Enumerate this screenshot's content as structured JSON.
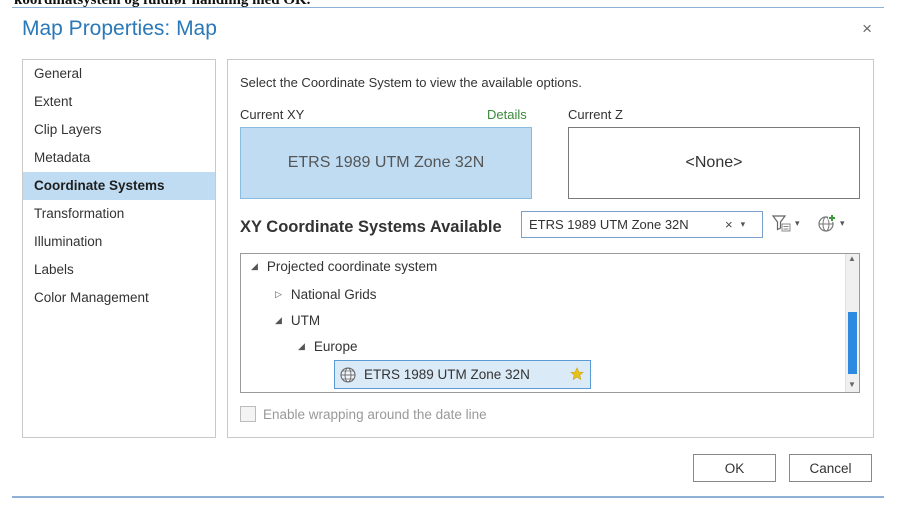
{
  "document": {
    "top_text": "koordinatsystem og fuldfør handling med OK."
  },
  "dialog": {
    "title": "Map Properties: Map",
    "close_glyph": "×",
    "nav": [
      {
        "label": "General"
      },
      {
        "label": "Extent"
      },
      {
        "label": "Clip Layers"
      },
      {
        "label": "Metadata"
      },
      {
        "label": "Coordinate Systems",
        "active": true
      },
      {
        "label": "Transformation"
      },
      {
        "label": "Illumination"
      },
      {
        "label": "Labels"
      },
      {
        "label": "Color Management"
      }
    ],
    "panel": {
      "instruction": "Select the Coordinate System to view the available options.",
      "current_xy_label": "Current XY",
      "details_link": "Details",
      "current_z_label": "Current Z",
      "current_xy_value": "ETRS 1989 UTM Zone 32N",
      "current_z_value": "<None>",
      "available_heading": "XY Coordinate Systems Available",
      "search_value": "ETRS 1989 UTM Zone 32N",
      "search_clear": "×",
      "tree": {
        "projected": "Projected coordinate system",
        "national_grids": "National Grids",
        "utm": "UTM",
        "europe": "Europe",
        "selected": "ETRS 1989 UTM Zone 32N"
      },
      "wrap_checkbox_label": "Enable wrapping around the date line",
      "wrap_checked": false
    },
    "buttons": {
      "ok": "OK",
      "cancel": "Cancel"
    }
  },
  "colors": {
    "title": "#2a78b8",
    "selection": "#bfdcf3",
    "scroll_thumb": "#2d8ae0",
    "details_link": "#3a8a3a",
    "favorite_star": "#e8c21a"
  }
}
